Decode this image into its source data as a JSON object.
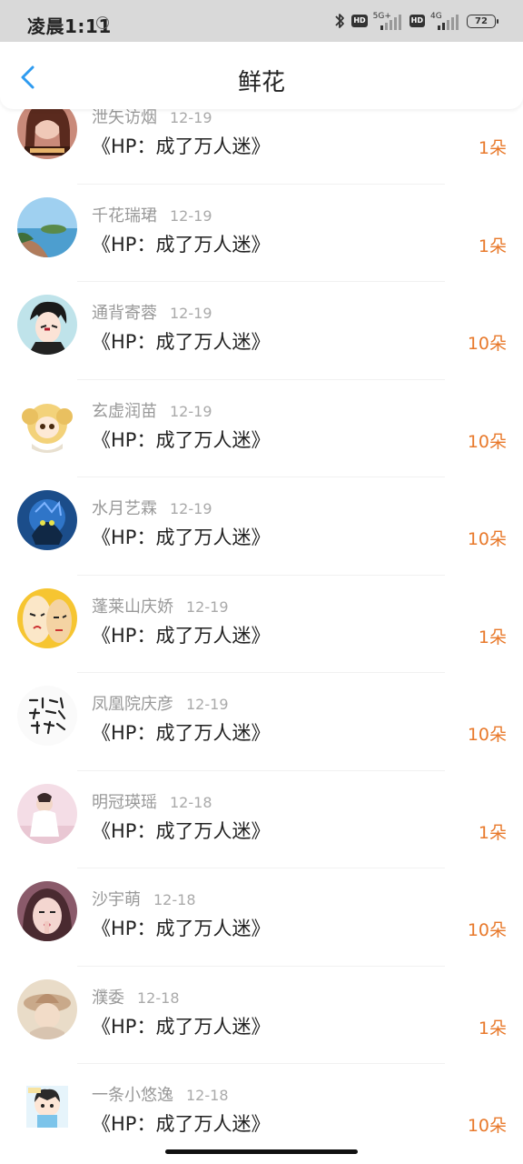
{
  "status_bar": {
    "time": "凌晨1:11",
    "hd1": "HD",
    "net1": "5G+",
    "hd2": "HD",
    "net2": "4G",
    "battery": "72"
  },
  "header": {
    "title": "鲜花"
  },
  "colors": {
    "accent_back": "#2e9bf0",
    "flower_count": "#e8792b",
    "status_bar_bg": "#d9d9d9"
  },
  "items": [
    {
      "name": "泄矢访烟",
      "date": "12-19",
      "book": "《HP：成了万人迷》",
      "count": "1朵",
      "avatar": "girl-portrait"
    },
    {
      "name": "千花瑞珺",
      "date": "12-19",
      "book": "《HP：成了万人迷》",
      "count": "1朵",
      "avatar": "seaside-island"
    },
    {
      "name": "通背寄蓉",
      "date": "12-19",
      "book": "《HP：成了万人迷》",
      "count": "10朵",
      "avatar": "anime-boy"
    },
    {
      "name": "玄虚润苗",
      "date": "12-19",
      "book": "《HP：成了万人迷》",
      "count": "10朵",
      "avatar": "cartoon-girl"
    },
    {
      "name": "水月艺霖",
      "date": "12-19",
      "book": "《HP：成了万人迷》",
      "count": "10朵",
      "avatar": "game-character"
    },
    {
      "name": "蓬莱山庆娇",
      "date": "12-19",
      "book": "《HP：成了万人迷》",
      "count": "1朵",
      "avatar": "cartoon-faces"
    },
    {
      "name": "凤凰院庆彦",
      "date": "12-19",
      "book": "《HP：成了万人迷》",
      "count": "10朵",
      "avatar": "calligraphy"
    },
    {
      "name": "明冠瑛瑶",
      "date": "12-18",
      "book": "《HP：成了万人迷》",
      "count": "1朵",
      "avatar": "pink-room"
    },
    {
      "name": "沙宇萌",
      "date": "12-18",
      "book": "《HP：成了万人迷》",
      "count": "10朵",
      "avatar": "girl-selfie"
    },
    {
      "name": "濮委",
      "date": "12-18",
      "book": "《HP：成了万人迷》",
      "count": "1朵",
      "avatar": "hat-girl"
    },
    {
      "name": "一条小悠逸",
      "date": "12-18",
      "book": "《HP：成了万人迷》",
      "count": "10朵",
      "avatar": "chibi-character"
    }
  ]
}
